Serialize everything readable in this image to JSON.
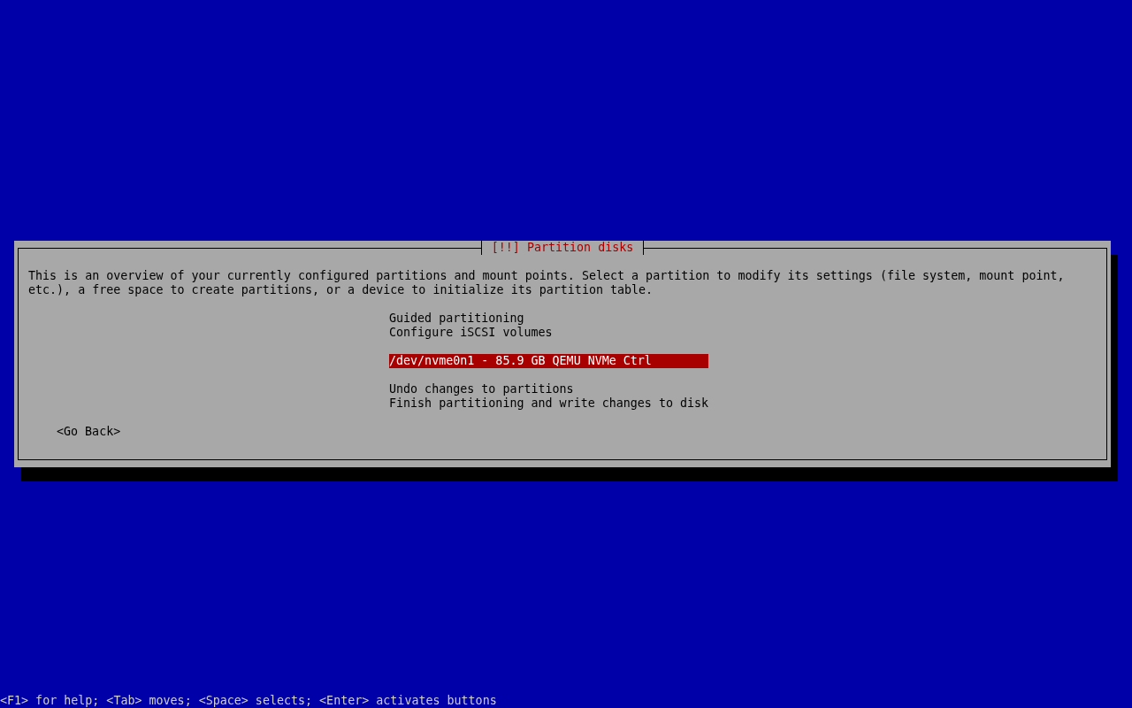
{
  "dialog": {
    "title": "[!!] Partition disks",
    "description": "This is an overview of your currently configured partitions and mount points. Select a partition to modify its settings (file system, mount point, etc.), a free space to create partitions, or a device to initialize its partition table.",
    "menu_groups": [
      [
        {
          "label": "Guided partitioning",
          "selected": false
        },
        {
          "label": "Configure iSCSI volumes",
          "selected": false
        }
      ],
      [
        {
          "label": "/dev/nvme0n1 - 85.9 GB QEMU NVMe Ctrl",
          "selected": true
        }
      ],
      [
        {
          "label": "Undo changes to partitions",
          "selected": false
        },
        {
          "label": "Finish partitioning and write changes to disk",
          "selected": false
        }
      ]
    ],
    "back_button": "<Go Back>"
  },
  "status_bar": "<F1> for help; <Tab> moves; <Space> selects; <Enter> activates buttons"
}
